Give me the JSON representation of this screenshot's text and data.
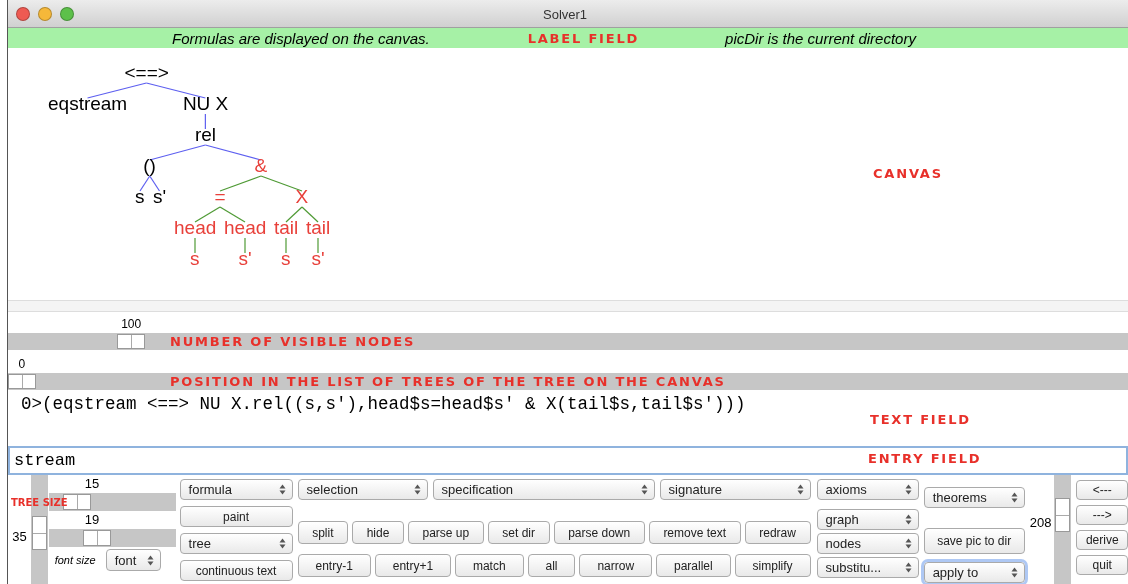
{
  "window": {
    "title": "Solver1"
  },
  "label_field": {
    "left": "Formulas are displayed on the canvas.",
    "annotation": "LABEL FIELD",
    "right": "picDir is the current directory"
  },
  "canvas": {
    "annotation": "CANVAS",
    "tree": {
      "label": "<==>",
      "color": "#000000",
      "children": [
        {
          "label": "eqstream",
          "color": "#000000"
        },
        {
          "label": "NU X",
          "color": "#000000",
          "children": [
            {
              "label": "rel",
              "color": "#000000",
              "children": [
                {
                  "label": "()",
                  "color": "#000000",
                  "children": [
                    {
                      "label": "s",
                      "color": "#000000"
                    },
                    {
                      "label": "s'",
                      "color": "#000000"
                    }
                  ]
                },
                {
                  "label": "&",
                  "color": "#e8403a",
                  "children": [
                    {
                      "label": "=",
                      "color": "#e8403a",
                      "children": [
                        {
                          "label": "head",
                          "color": "#e8403a",
                          "children": [
                            {
                              "label": "s",
                              "color": "#e8403a"
                            }
                          ]
                        },
                        {
                          "label": "head",
                          "color": "#e8403a",
                          "children": [
                            {
                              "label": "s'",
                              "color": "#e8403a"
                            }
                          ]
                        }
                      ]
                    },
                    {
                      "label": "X",
                      "color": "#e8403a",
                      "children": [
                        {
                          "label": "tail",
                          "color": "#e8403a",
                          "children": [
                            {
                              "label": "s",
                              "color": "#e8403a"
                            }
                          ]
                        },
                        {
                          "label": "tail",
                          "color": "#e8403a",
                          "children": [
                            {
                              "label": "s'",
                              "color": "#e8403a"
                            }
                          ]
                        }
                      ]
                    }
                  ]
                }
              ]
            }
          ]
        }
      ]
    }
  },
  "visible_nodes_slider": {
    "value": "100",
    "level": 0.1,
    "annotation": "NUMBER OF VISIBLE NODES"
  },
  "tree_position_slider": {
    "value": "0",
    "level": 0,
    "annotation": "POSITION IN THE LIST OF TREES OF THE TREE ON THE CANVAS"
  },
  "text_field": {
    "text": "0>(eqstream <==> NU X.rel((s,s'),head$s=head$s' & X(tail$s,tail$s')))",
    "annotation": "TEXT FIELD"
  },
  "entry_field": {
    "value": "stream",
    "annotation": "ENTRY FIELD"
  },
  "tree_size": {
    "annotation": "TREE SIZE",
    "value": "35",
    "level": 0.55
  },
  "size_sliders": [
    {
      "value": "15",
      "level": 0.15
    },
    {
      "value": "19",
      "level": 0.35
    }
  ],
  "font_size": {
    "label": "font size",
    "dropdown": "font"
  },
  "view_column": [
    {
      "kind": "dropdown",
      "label": "formula",
      "focused": false
    },
    {
      "kind": "button",
      "label": "paint",
      "focused": false
    },
    {
      "kind": "dropdown",
      "label": "tree",
      "focused": false
    },
    {
      "kind": "button",
      "label": "continuous text",
      "focused": false
    }
  ],
  "menus": [
    {
      "kind": "dropdown",
      "label": "selection",
      "focused": false
    },
    {
      "kind": "dropdown",
      "label": "specification",
      "focused": false
    },
    {
      "kind": "dropdown",
      "label": "signature",
      "focused": false
    }
  ],
  "button_rows": [
    [
      {
        "kind": "button",
        "label": "split",
        "focused": false
      },
      {
        "kind": "button",
        "label": "hide",
        "focused": false
      },
      {
        "kind": "button",
        "label": "parse up",
        "focused": false
      },
      {
        "kind": "button",
        "label": "set dir",
        "focused": false
      },
      {
        "kind": "button",
        "label": "parse down",
        "focused": false
      },
      {
        "kind": "button",
        "label": "remove text",
        "focused": false
      },
      {
        "kind": "button",
        "label": "redraw",
        "focused": false
      }
    ],
    [
      {
        "kind": "button",
        "label": "entry-1",
        "focused": false
      },
      {
        "kind": "button",
        "label": "entry+1",
        "focused": false
      },
      {
        "kind": "button",
        "label": "match",
        "focused": false
      },
      {
        "kind": "button",
        "label": "all",
        "focused": false
      },
      {
        "kind": "button",
        "label": "narrow",
        "focused": false
      },
      {
        "kind": "button",
        "label": "parallel",
        "focused": false
      },
      {
        "kind": "button",
        "label": "simplify",
        "focused": false
      }
    ]
  ],
  "axioms_column": [
    {
      "kind": "dropdown",
      "label": "axioms",
      "focused": false
    },
    {
      "kind": "dropdown",
      "label": "graph",
      "focused": false
    },
    {
      "kind": "dropdown",
      "label": "nodes",
      "focused": false
    },
    {
      "kind": "dropdown",
      "label": "substitu...",
      "focused": false
    }
  ],
  "theorems_column": [
    {
      "kind": "dropdown",
      "label": "theorems",
      "focused": false
    },
    {
      "kind": "button",
      "label": "save pic to dir",
      "focused": false
    },
    {
      "kind": "dropdown",
      "label": "apply to",
      "focused": true
    }
  ],
  "proof_slider": {
    "value": "208",
    "level": 0.3
  },
  "nav_buttons": [
    {
      "kind": "button",
      "label": "<---",
      "focused": false
    },
    {
      "kind": "button",
      "label": "--->",
      "focused": false
    },
    {
      "kind": "button",
      "label": "derive",
      "focused": false
    },
    {
      "kind": "button",
      "label": "quit",
      "focused": false
    }
  ]
}
